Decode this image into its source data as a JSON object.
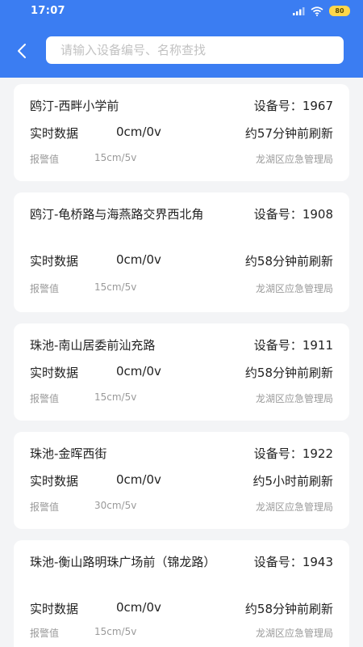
{
  "status_bar": {
    "time": "17:07",
    "battery_label": "80",
    "icons": [
      "signal-icon",
      "wifi-icon",
      "battery-icon"
    ]
  },
  "header": {
    "back_icon": "chevron-left-icon",
    "search_placeholder": "请输入设备编号、名称查找",
    "background_color": "#3b7df2"
  },
  "device_label": "设备号：",
  "realtime_label": "实时数据",
  "alarm_label": "报警值",
  "devices": [
    {
      "name": "鸥汀-西畔小学前",
      "device_no": "1967",
      "realtime_value": "0cm/0v",
      "refresh": "约57分钟前刷新",
      "alarm_value": "15cm/5v",
      "department": "龙湖区应急管理局"
    },
    {
      "name": "鸥汀-龟桥路与海燕路交界西北角",
      "device_no": "1908",
      "realtime_value": "0cm/0v",
      "refresh": "约58分钟前刷新",
      "alarm_value": "15cm/5v",
      "department": "龙湖区应急管理局"
    },
    {
      "name": "珠池-南山居委前汕充路",
      "device_no": "1911",
      "realtime_value": "0cm/0v",
      "refresh": "约58分钟前刷新",
      "alarm_value": "15cm/5v",
      "department": "龙湖区应急管理局"
    },
    {
      "name": "珠池-金晖西街",
      "device_no": "1922",
      "realtime_value": "0cm/0v",
      "refresh": "约5小时前刷新",
      "alarm_value": "30cm/5v",
      "department": "龙湖区应急管理局"
    },
    {
      "name": "珠池-衡山路明珠广场前（锦龙路）",
      "device_no": "1943",
      "realtime_value": "0cm/0v",
      "refresh": "约58分钟前刷新",
      "alarm_value": "15cm/5v",
      "department": "龙湖区应急管理局"
    }
  ]
}
